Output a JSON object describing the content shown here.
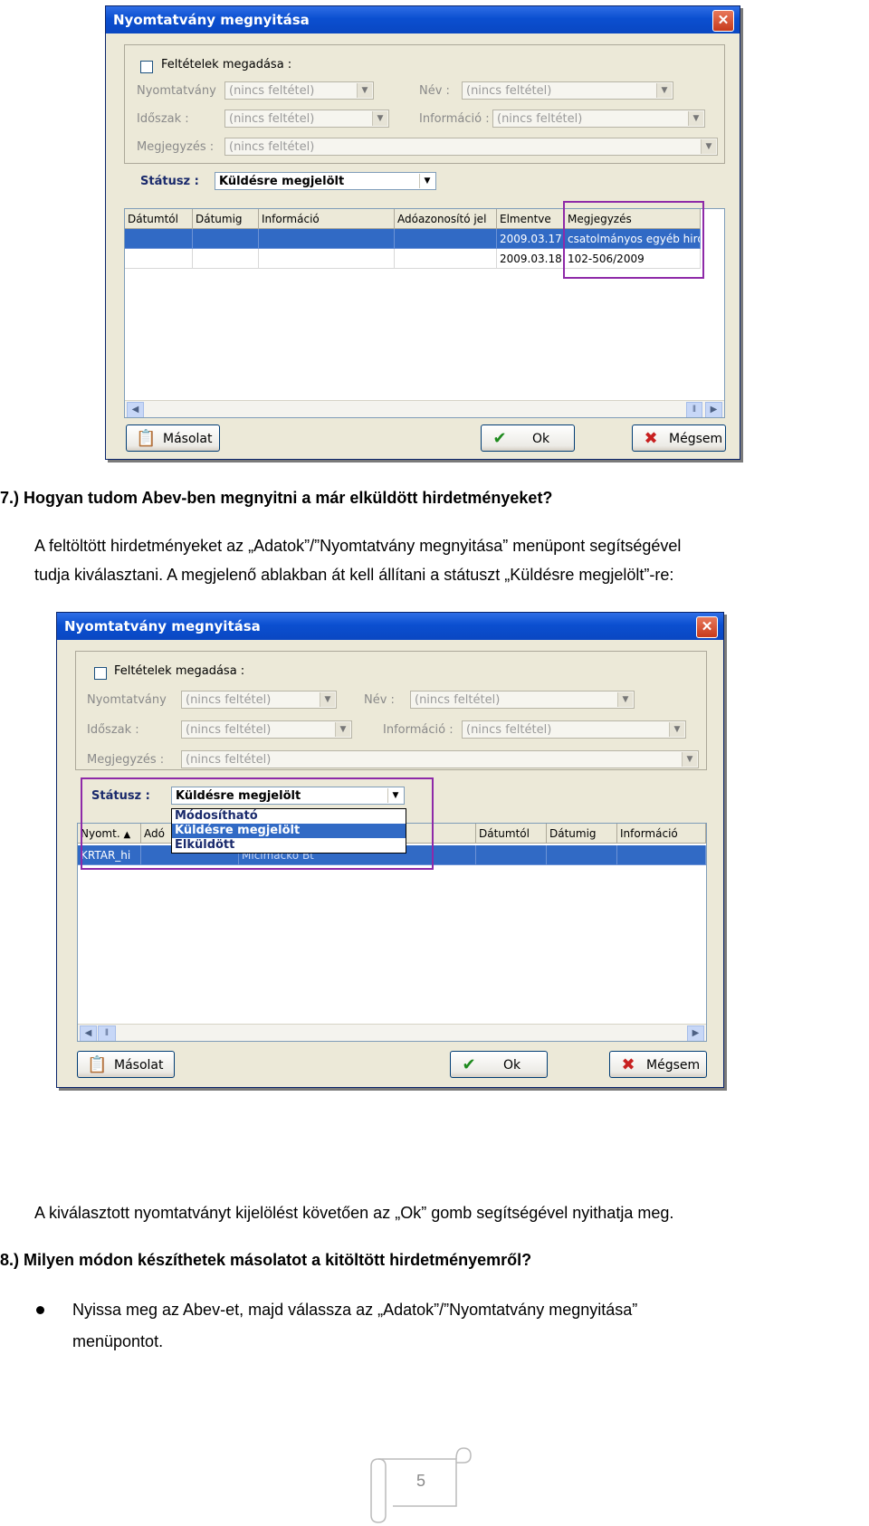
{
  "dialog1": {
    "title": "Nyomtatvány megnyitása",
    "conditions_label": "Feltételek megadása :",
    "filters": {
      "nyomtatvany_label": "Nyomtatvány",
      "nyomtatvany_value": "(nincs feltétel)",
      "nev_label": "Név :",
      "nev_value": "(nincs feltétel)",
      "idoszak_label": "Időszak :",
      "idoszak_value": "(nincs feltétel)",
      "informacio_label": "Információ :",
      "informacio_value": "(nincs feltétel)",
      "megjegyzes_label": "Megjegyzés :",
      "megjegyzes_value": "(nincs feltétel)"
    },
    "status_label": "Státusz :",
    "status_value": "Küldésre megjelölt",
    "columns": [
      "Dátumtól",
      "Dátumig",
      "Információ",
      "Adóazonosító jel",
      "Elmentve",
      "Megjegyzés"
    ],
    "rows": [
      {
        "elmentve": "2009.03.17",
        "megjegyzes": "csatolmányos egyéb hird"
      },
      {
        "elmentve": "2009.03.18",
        "megjegyzes": "102-506/2009"
      }
    ],
    "buttons": {
      "copy": "Másolat",
      "ok": "Ok",
      "cancel": "Mégsem"
    }
  },
  "section7": {
    "heading": "7.) Hogyan tudom Abev-ben megnyitni a már elküldött hirdetményeket?",
    "line1": "A feltöltött hirdetményeket az „Adatok”/”Nyomtatvány megnyitása” menüpont segítségével",
    "line2": "tudja kiválasztani. A megjelenő ablakban át kell állítani a státuszt „Küldésre megjelölt”-re:"
  },
  "dialog2": {
    "title": "Nyomtatvány megnyitása",
    "conditions_label": "Feltételek megadása :",
    "filters": {
      "nyomtatvany_label": "Nyomtatvány",
      "nyomtatvany_value": "(nincs feltétel)",
      "nev_label": "Név :",
      "nev_value": "(nincs feltétel)",
      "idoszak_label": "Időszak :",
      "idoszak_value": "(nincs feltétel)",
      "informacio_label": "Információ :",
      "informacio_value": "(nincs feltétel)",
      "megjegyzes_label": "Megjegyzés :",
      "megjegyzes_value": "(nincs feltétel)"
    },
    "status_label": "Státusz :",
    "status_value": "Küldésre megjelölt",
    "status_options": [
      "Módosítható",
      "Küldésre megjelölt",
      "Elküldött"
    ],
    "columns": {
      "nyomt": "Nyomt.",
      "ado": "Adó",
      "datumtol": "Dátumtól",
      "datumig": "Dátumig",
      "informacio": "Információ"
    },
    "row": {
      "nyomt": "KRTAR_hi",
      "nev": "Micimackó Bt"
    },
    "buttons": {
      "copy": "Másolat",
      "ok": "Ok",
      "cancel": "Mégsem"
    }
  },
  "after_text": "A kiválasztott nyomtatványt kijelölést követően az „Ok” gomb segítségével nyithatja meg.",
  "section8": {
    "heading": "8.) Milyen módon készíthetek másolatot a kitöltött hirdetményemről?",
    "bullet_line1": "Nyissa meg az Abev-et, majd válassza az „Adatok”/”Nyomtatvány megnyitása”",
    "bullet_line2": "menüpontot."
  },
  "page_number": "5"
}
